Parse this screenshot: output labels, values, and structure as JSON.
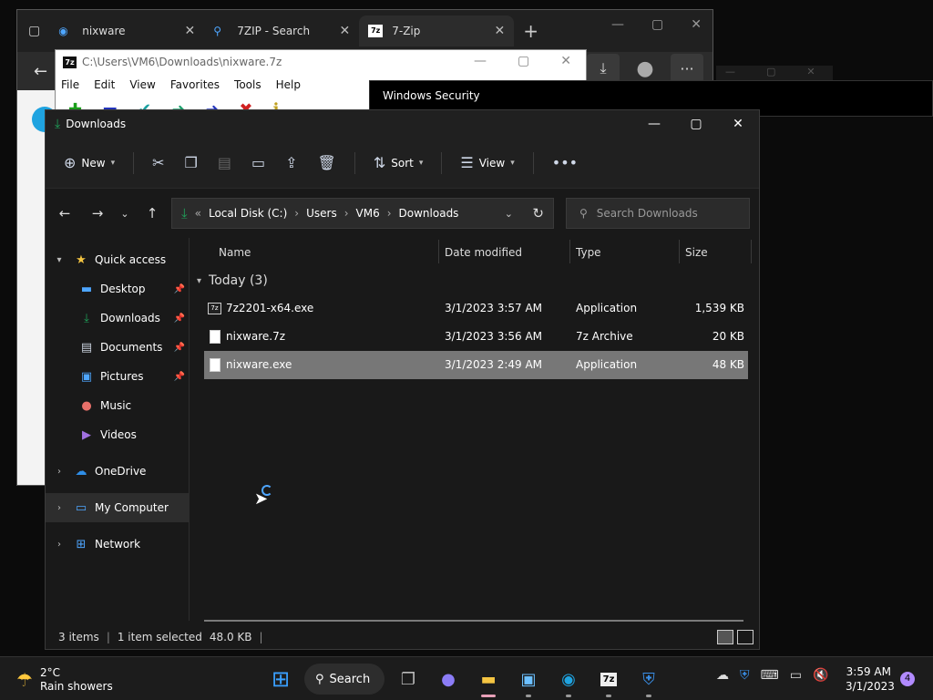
{
  "browser": {
    "tabs": [
      {
        "label": "nixware",
        "close": "✕"
      },
      {
        "label": "7ZIP - Search",
        "close": "✕"
      },
      {
        "label": "7-Zip",
        "close": "✕"
      }
    ],
    "new_tab": "+",
    "tools": {
      "download": "⤓",
      "profile": "●",
      "more": "···"
    }
  },
  "sevenzip": {
    "title": "C:\\Users\\VM6\\Downloads\\nixware.7z",
    "icon_text": "7z",
    "menu": [
      "File",
      "Edit",
      "View",
      "Favorites",
      "Tools",
      "Help"
    ]
  },
  "winsec": {
    "title": "Windows Security"
  },
  "explorer": {
    "title": "Downloads",
    "commands": {
      "new": "New",
      "sort": "Sort",
      "view": "View"
    },
    "address": {
      "prefix": "«",
      "crumbs": [
        "Local Disk (C:)",
        "Users",
        "VM6",
        "Downloads"
      ]
    },
    "search_placeholder": "Search Downloads",
    "sidebar": [
      {
        "label": "Quick access",
        "icon": "star-icon"
      },
      {
        "label": "Desktop",
        "icon": "desktop-icon"
      },
      {
        "label": "Downloads",
        "icon": "download-icon"
      },
      {
        "label": "Documents",
        "icon": "documents-icon"
      },
      {
        "label": "Pictures",
        "icon": "pictures-icon"
      },
      {
        "label": "Music",
        "icon": "music-icon"
      },
      {
        "label": "Videos",
        "icon": "videos-icon"
      },
      {
        "label": "OneDrive",
        "icon": "cloud-icon"
      },
      {
        "label": "My Computer",
        "icon": "computer-icon"
      },
      {
        "label": "Network",
        "icon": "network-icon"
      }
    ],
    "columns": [
      "Name",
      "Date modified",
      "Type",
      "Size"
    ],
    "group": "Today (3)",
    "files": [
      {
        "name": "7z2201-x64.exe",
        "date": "3/1/2023 3:57 AM",
        "type": "Application",
        "size": "1,539 KB"
      },
      {
        "name": "nixware.7z",
        "date": "3/1/2023 3:56 AM",
        "type": "7z Archive",
        "size": "20 KB"
      },
      {
        "name": "nixware.exe",
        "date": "3/1/2023 2:49 AM",
        "type": "Application",
        "size": "48 KB"
      }
    ],
    "status": {
      "items": "3 items",
      "selected": "1 item selected",
      "size": "48.0 KB"
    }
  },
  "taskbar": {
    "weather_temp": "2°C",
    "weather_desc": "Rain showers",
    "search_label": "Search",
    "time": "3:59 AM",
    "date": "3/1/2023",
    "notifications": "4"
  },
  "colors": {
    "accent": "#4ea6ff",
    "downloads_green": "#1fa25a",
    "selection": "#777777"
  }
}
